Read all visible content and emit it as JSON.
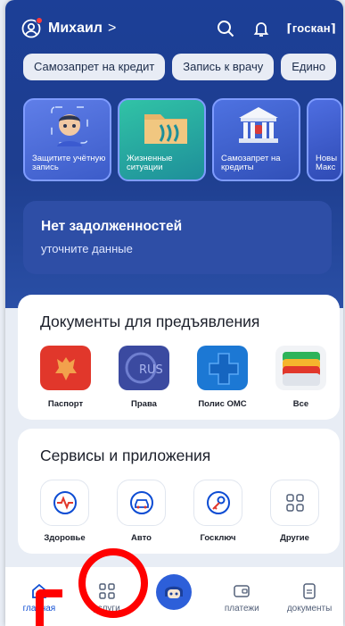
{
  "header": {
    "username": "Михаил",
    "chevron": ">",
    "logo": "госкан"
  },
  "chips": [
    "Самозапрет на кредит",
    "Запись к врачу",
    "Едино"
  ],
  "stories": [
    {
      "label": "Защитите учётную запись",
      "icon": "user-shield-icon"
    },
    {
      "label": "Жизненные ситуации",
      "icon": "folder-icon"
    },
    {
      "label": "Самозапрет на кредиты",
      "icon": "bank-icon"
    },
    {
      "label": "Новы Макс",
      "icon": "cut-off-story-icon"
    }
  ],
  "debt": {
    "title": "Нет задолженностей",
    "subtitle": "уточните данные"
  },
  "documents": {
    "title": "Документы для предъявления",
    "items": [
      {
        "label": "Паспорт",
        "color": "#e1372b"
      },
      {
        "label": "Права",
        "color": "#3b4aa0"
      },
      {
        "label": "Полис ОМС",
        "color": "#1c78d4"
      },
      {
        "label": "Все",
        "color": "#f5b52d"
      }
    ]
  },
  "services": {
    "title": "Сервисы и приложения",
    "items": [
      {
        "label": "Здоровье",
        "icon": "heartbeat-icon"
      },
      {
        "label": "Авто",
        "icon": "car-icon"
      },
      {
        "label": "Госключ",
        "icon": "key-icon"
      },
      {
        "label": "Другие",
        "icon": "grid-icon"
      }
    ]
  },
  "tabs": [
    {
      "label": "главная",
      "icon": "home-icon",
      "active": true
    },
    {
      "label": "услуги",
      "icon": "grid-icon"
    },
    {
      "label": "",
      "icon": "assistant-robot-icon"
    },
    {
      "label": "платежи",
      "icon": "wallet-icon"
    },
    {
      "label": "документы",
      "icon": "document-icon"
    }
  ],
  "colors": {
    "hero_blue": "#1c3f97",
    "accent": "#0d4cd3",
    "annotation": "#ff0000"
  }
}
